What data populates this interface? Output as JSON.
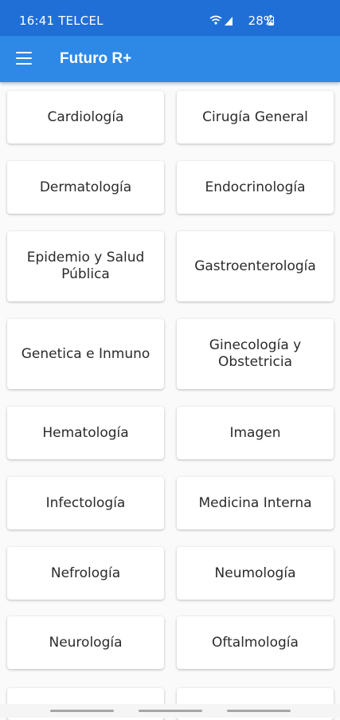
{
  "status_bar": {
    "time_carrier": "16:41 TELCEL",
    "battery": "28%"
  },
  "app_bar": {
    "title": "Futuro R+",
    "menu_icon": "hamburger-menu-icon"
  },
  "colors": {
    "status_bar": "#1f6fd6",
    "app_bar": "#2e88e6",
    "background": "#fafafa",
    "card": "#ffffff"
  },
  "specialties": [
    "Cardiología",
    "Cirugía General",
    "Dermatología",
    "Endocrinología",
    "Epidemio y Salud Pública",
    "Gastroenterología",
    "Genetica e Inmuno",
    "Ginecología y Obstetricia",
    "Hematología",
    "Imagen",
    "Infectología",
    "Medicina Interna",
    "Nefrología",
    "Neumología",
    "Neurología",
    "Oftalmología"
  ]
}
